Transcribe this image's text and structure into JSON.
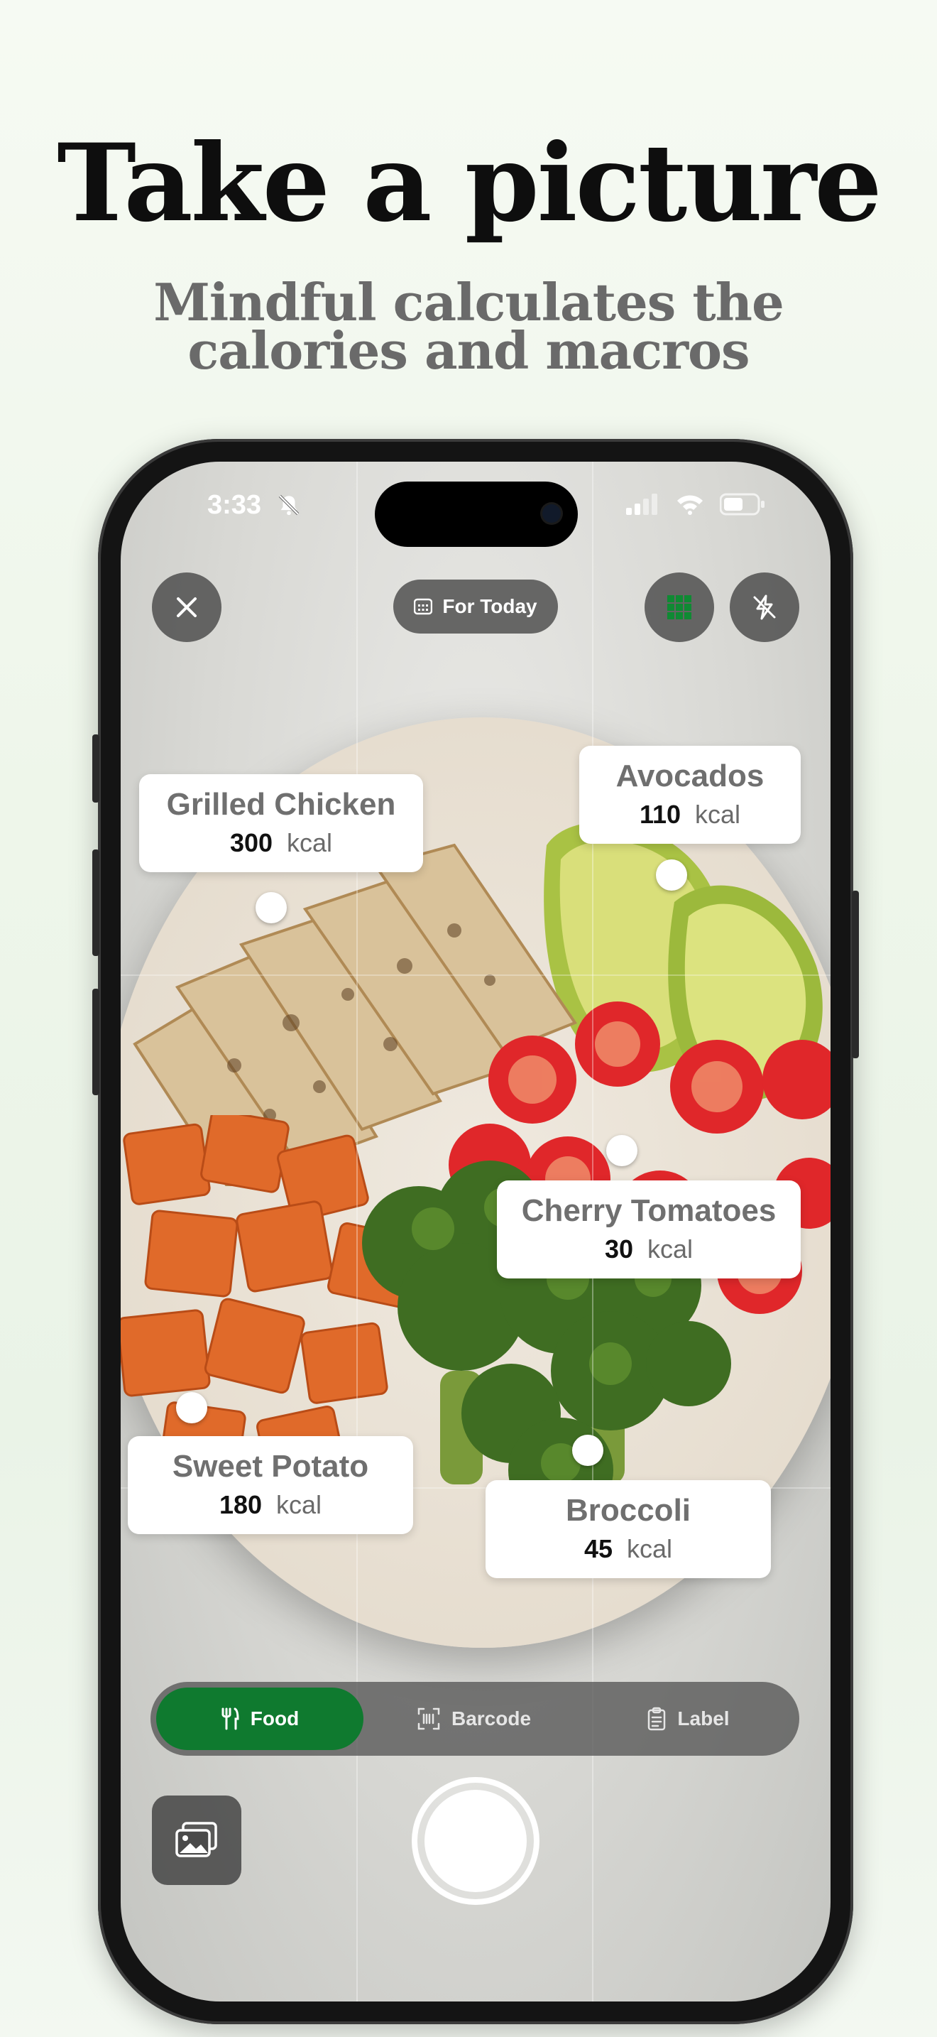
{
  "headline": "Take a picture",
  "subheadline": {
    "line1": "Mindful calculates the",
    "line2": "calories and macros"
  },
  "status_bar": {
    "time": "3:33"
  },
  "top_bar": {
    "date_pill_label": "For Today"
  },
  "food_tags": [
    {
      "name": "Grilled Chicken",
      "kcal_value": "300",
      "unit": "kcal"
    },
    {
      "name": "Avocados",
      "kcal_value": "110",
      "unit": "kcal"
    },
    {
      "name": "Cherry Tomatoes",
      "kcal_value": "30",
      "unit": "kcal"
    },
    {
      "name": "Sweet Potato",
      "kcal_value": "180",
      "unit": "kcal"
    },
    {
      "name": "Broccoli",
      "kcal_value": "45",
      "unit": "kcal"
    }
  ],
  "mode_bar": {
    "food": "Food",
    "barcode": "Barcode",
    "label": "Label",
    "selected": "Food"
  },
  "colors": {
    "accent_green": "#0f7a2f",
    "headline": "#0e0e0e",
    "subheadline": "#6a6a6a"
  }
}
